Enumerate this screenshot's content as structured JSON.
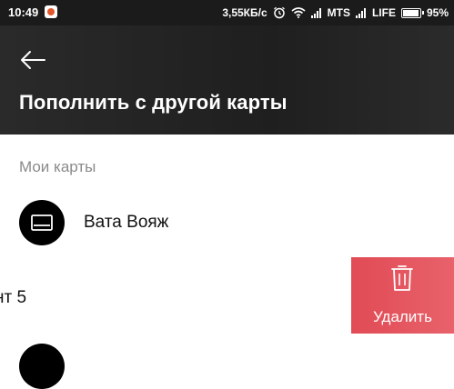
{
  "status_bar": {
    "time": "10:49",
    "speed": "3,55КБ/с",
    "carrier1": "MTS",
    "carrier2": "LIFE",
    "battery_percent_text": "95%",
    "battery_level": 0.95
  },
  "toolbar": {
    "back_icon": "arrow-left-icon",
    "title": "Пополнить с другой карты"
  },
  "section": {
    "label": "Мои карты"
  },
  "cards": [
    {
      "name": "Вата Вояж",
      "icon": "card-icon"
    }
  ],
  "swiped_row": {
    "partial_text": "нт 5",
    "delete_label": "Удалить",
    "delete_icon": "trash-icon"
  },
  "colors": {
    "toolbar": "#222222",
    "delete": "#e14b55"
  }
}
